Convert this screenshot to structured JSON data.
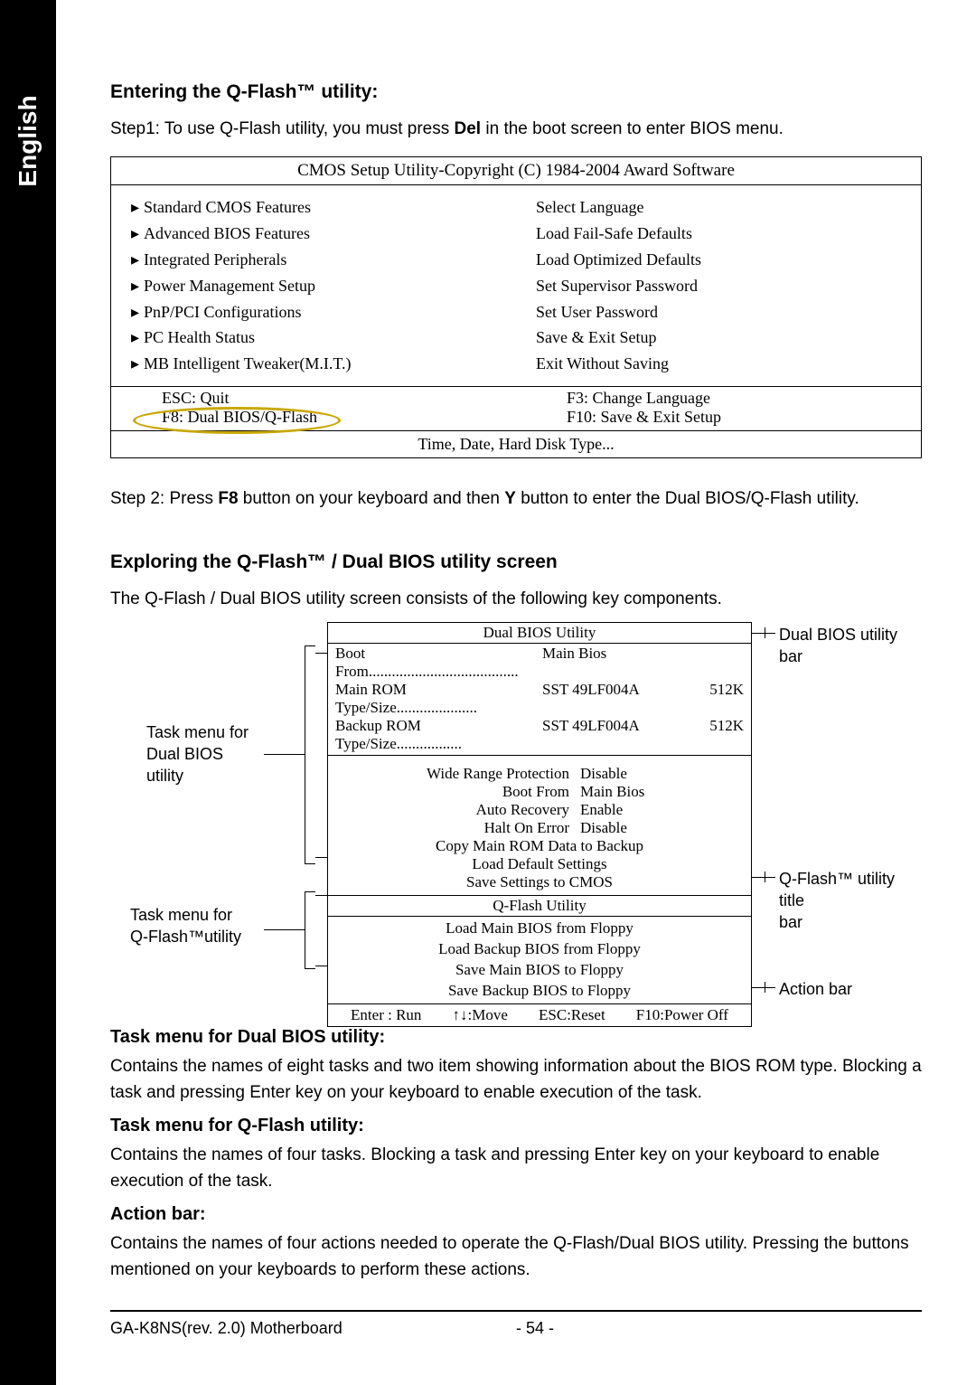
{
  "sideTab": "English",
  "section1": {
    "heading": "Entering the Q-Flash™ utility:",
    "step1_pre": "Step1: To use Q-Flash utility, you must press ",
    "step1_key": "Del",
    "step1_post": " in the boot screen to enter BIOS menu."
  },
  "biosBox": {
    "title": "CMOS Setup Utility-Copyright (C) 1984-2004 Award Software",
    "left": [
      "Standard CMOS Features",
      "Advanced BIOS Features",
      "Integrated Peripherals",
      "Power Management Setup",
      "PnP/PCI Configurations",
      "PC Health Status",
      "MB Intelligent Tweaker(M.I.T.)"
    ],
    "right": [
      "Select Language",
      "Load Fail-Safe Defaults",
      "Load Optimized Defaults",
      "Set Supervisor Password",
      "Set User Password",
      "Save & Exit Setup",
      "Exit Without Saving"
    ],
    "foot": {
      "l1": "ESC: Quit",
      "l2": "F8: Dual BIOS/Q-Flash",
      "r1": "F3: Change Language",
      "r2": "F10: Save & Exit Setup"
    },
    "hint": "Time, Date, Hard Disk Type..."
  },
  "step2": {
    "pre": "Step 2: Press ",
    "k1": "F8",
    "mid": " button on your keyboard and then ",
    "k2": "Y",
    "post": " button to enter the Dual BIOS/Q-Flash utility."
  },
  "section2": {
    "heading": "Exploring the Q-Flash™ / Dual BIOS utility screen",
    "intro": "The Q-Flash / Dual BIOS utility screen consists of the following key components."
  },
  "util": {
    "title": "Dual BIOS Utility",
    "info": [
      {
        "c1": "Boot From.......................................",
        "c2": "Main Bios",
        "c3": ""
      },
      {
        "c1": "Main ROM Type/Size.....................",
        "c2": "SST 49LF004A",
        "c3": "512K"
      },
      {
        "c1": "Backup ROM Type/Size.................",
        "c2": "SST 49LF004A",
        "c3": "512K"
      }
    ],
    "tasks_kv": [
      {
        "k": "Wide Range Protection",
        "v": "Disable"
      },
      {
        "k": "Boot From",
        "v": "Main Bios"
      },
      {
        "k": "Auto Recovery",
        "v": "Enable"
      },
      {
        "k": "Halt On Error",
        "v": "Disable"
      }
    ],
    "tasks_single": [
      "Copy Main ROM Data to Backup",
      "Load Default Settings",
      "Save Settings to CMOS"
    ],
    "qtitle": "Q-Flash Utility",
    "qtasks": [
      "Load Main BIOS from Floppy",
      "Load Backup BIOS from Floppy",
      "Save Main BIOS to Floppy",
      "Save Backup BIOS to Floppy"
    ],
    "action": [
      "Enter : Run",
      "↑↓:Move",
      "ESC:Reset",
      "F10:Power Off"
    ]
  },
  "labels": {
    "dualBar": "Dual BIOS utility bar",
    "taskDual": "Task menu for\nDual BIOS\nutility",
    "taskQ": "Task menu for\nQ-Flash™utility",
    "qBar": "Q-Flash™ utility title\nbar",
    "actionBar": "Action bar"
  },
  "desc": {
    "h1": "Task menu for Dual BIOS utility:",
    "p1": "Contains the names of eight tasks and two item showing information about the BIOS ROM type. Blocking a task and pressing Enter key on your keyboard to enable execution of the task.",
    "h2": "Task menu for Q-Flash utility:",
    "p2": "Contains the names of four tasks. Blocking a task and pressing Enter key on your keyboard to enable execution of the task.",
    "h3": "Action bar:",
    "p3": "Contains the names of four actions needed to operate the Q-Flash/Dual BIOS utility. Pressing the buttons mentioned on your keyboards to perform these actions."
  },
  "footer": {
    "left": "GA-K8NS(rev. 2.0) Motherboard",
    "right": "- 54 -"
  }
}
